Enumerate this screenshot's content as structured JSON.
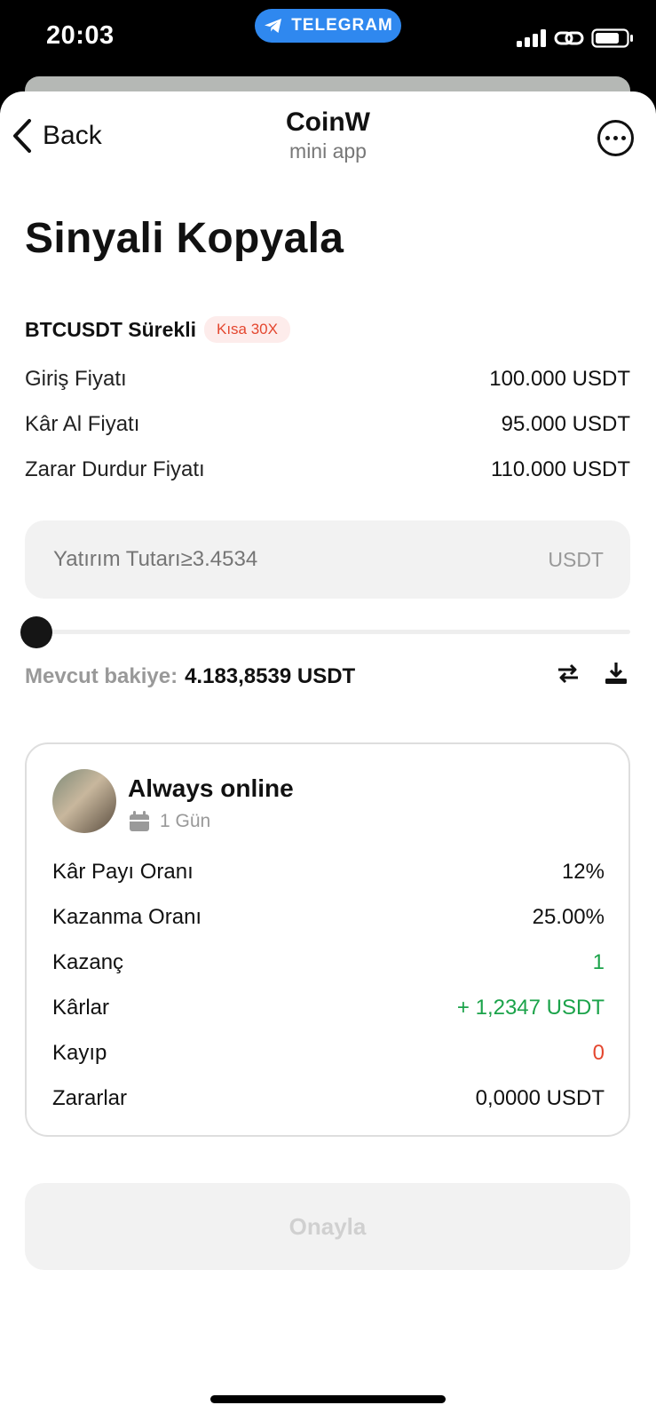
{
  "status_bar": {
    "time": "20:03",
    "telegram_label": "TELEGRAM"
  },
  "nav": {
    "back_label": "Back",
    "title": "CoinW",
    "subtitle": "mini app"
  },
  "page_title": "Sinyali Kopyala",
  "pair": {
    "name": "BTCUSDT Sürekli",
    "badge": "Kısa 30X"
  },
  "prices": [
    {
      "label": "Giriş Fiyatı",
      "value": "100.000 USDT"
    },
    {
      "label": "Kâr Al Fiyatı",
      "value": "95.000 USDT"
    },
    {
      "label": "Zarar Durdur Fiyatı",
      "value": "110.000 USDT"
    }
  ],
  "amount": {
    "placeholder": "Yatırım Tutarı≥3.4534",
    "unit": "USDT",
    "slider_percent": 0
  },
  "balance": {
    "label": "Mevcut bakiye:",
    "value": "4.183,8539 USDT"
  },
  "trader": {
    "name": "Always online",
    "duration": "1 Gün",
    "stats": [
      {
        "label": "Kâr Payı Oranı",
        "value": "12%",
        "color": "#111111"
      },
      {
        "label": "Kazanma Oranı",
        "value": "25.00%",
        "color": "#111111"
      },
      {
        "label": "Kazanç",
        "value": "1",
        "color": "#1ba34a"
      },
      {
        "label": "Kârlar",
        "value": "+ 1,2347 USDT",
        "color": "#1ba34a"
      },
      {
        "label": "Kayıp",
        "value": "0",
        "color": "#e4472f"
      },
      {
        "label": "Zararlar",
        "value": "0,0000 USDT",
        "color": "#111111"
      }
    ]
  },
  "confirm_label": "Onayla",
  "icons": [
    "telegram-icon",
    "signal-icon",
    "link-icon",
    "battery-icon",
    "back-chevron-icon",
    "more-icon",
    "transfer-icon",
    "download-icon",
    "calendar-icon"
  ]
}
